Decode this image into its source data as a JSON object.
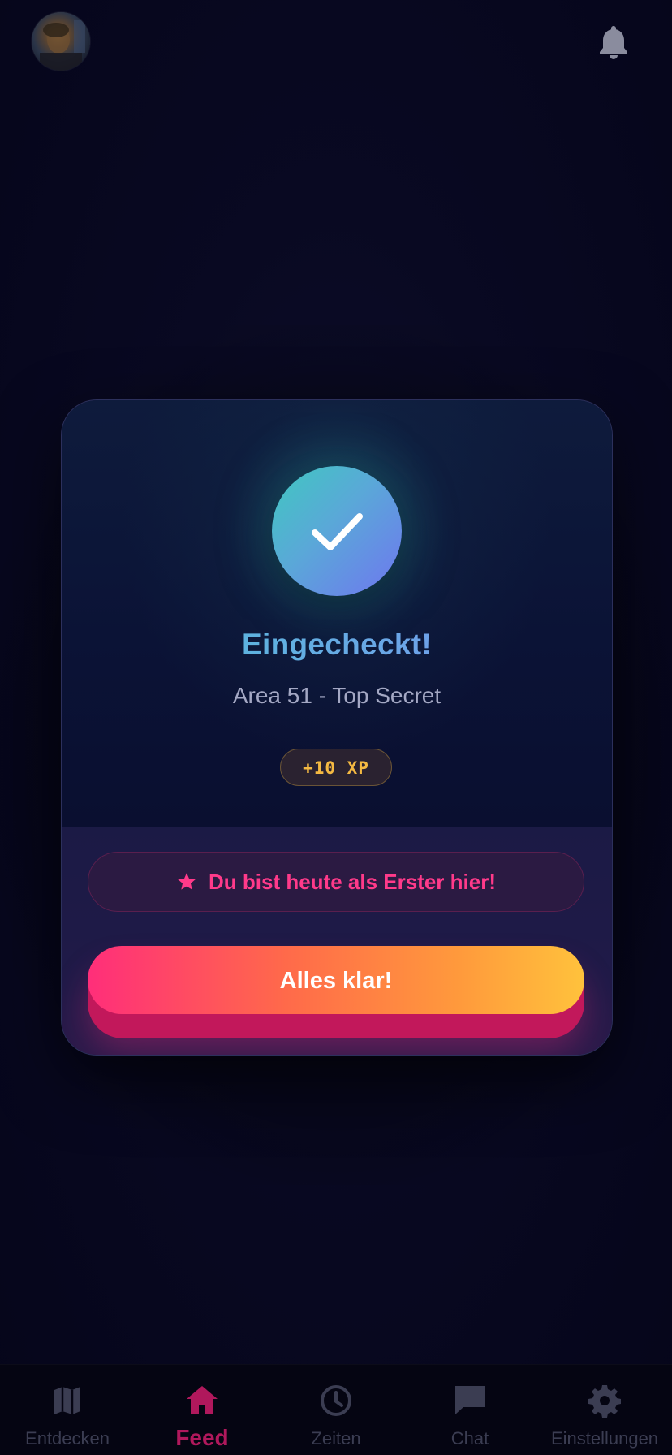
{
  "header": {
    "avatar": {
      "icon": "user-avatar",
      "interactable": true
    },
    "notifications": {
      "icon": "bell-icon"
    }
  },
  "modal": {
    "icon": "checkmark-icon",
    "title": "Eingecheckt!",
    "location": "Area 51 - Top Secret",
    "xp_badge": "+10 XP",
    "first_banner": {
      "icon": "star-icon",
      "text": "Du bist heute als Erster hier!"
    },
    "confirm_label": "Alles klar!"
  },
  "bottom_nav": {
    "active": "Feed",
    "items": [
      {
        "label": "Entdecken",
        "icon": "map-icon"
      },
      {
        "label": "Feed",
        "icon": "home-icon"
      },
      {
        "label": "Zeiten",
        "icon": "clock-icon"
      },
      {
        "label": "Chat",
        "icon": "chat-icon"
      },
      {
        "label": "Einstellungen",
        "icon": "gear-icon"
      }
    ]
  },
  "colors": {
    "accent_pink": "#ff3a8a",
    "nav_active": "#b0185c",
    "nav_inactive": "#3b3d52",
    "xp_gold": "#f4b942",
    "check_gradient_start": "#3fc8c0",
    "check_gradient_end": "#6f76f0"
  }
}
